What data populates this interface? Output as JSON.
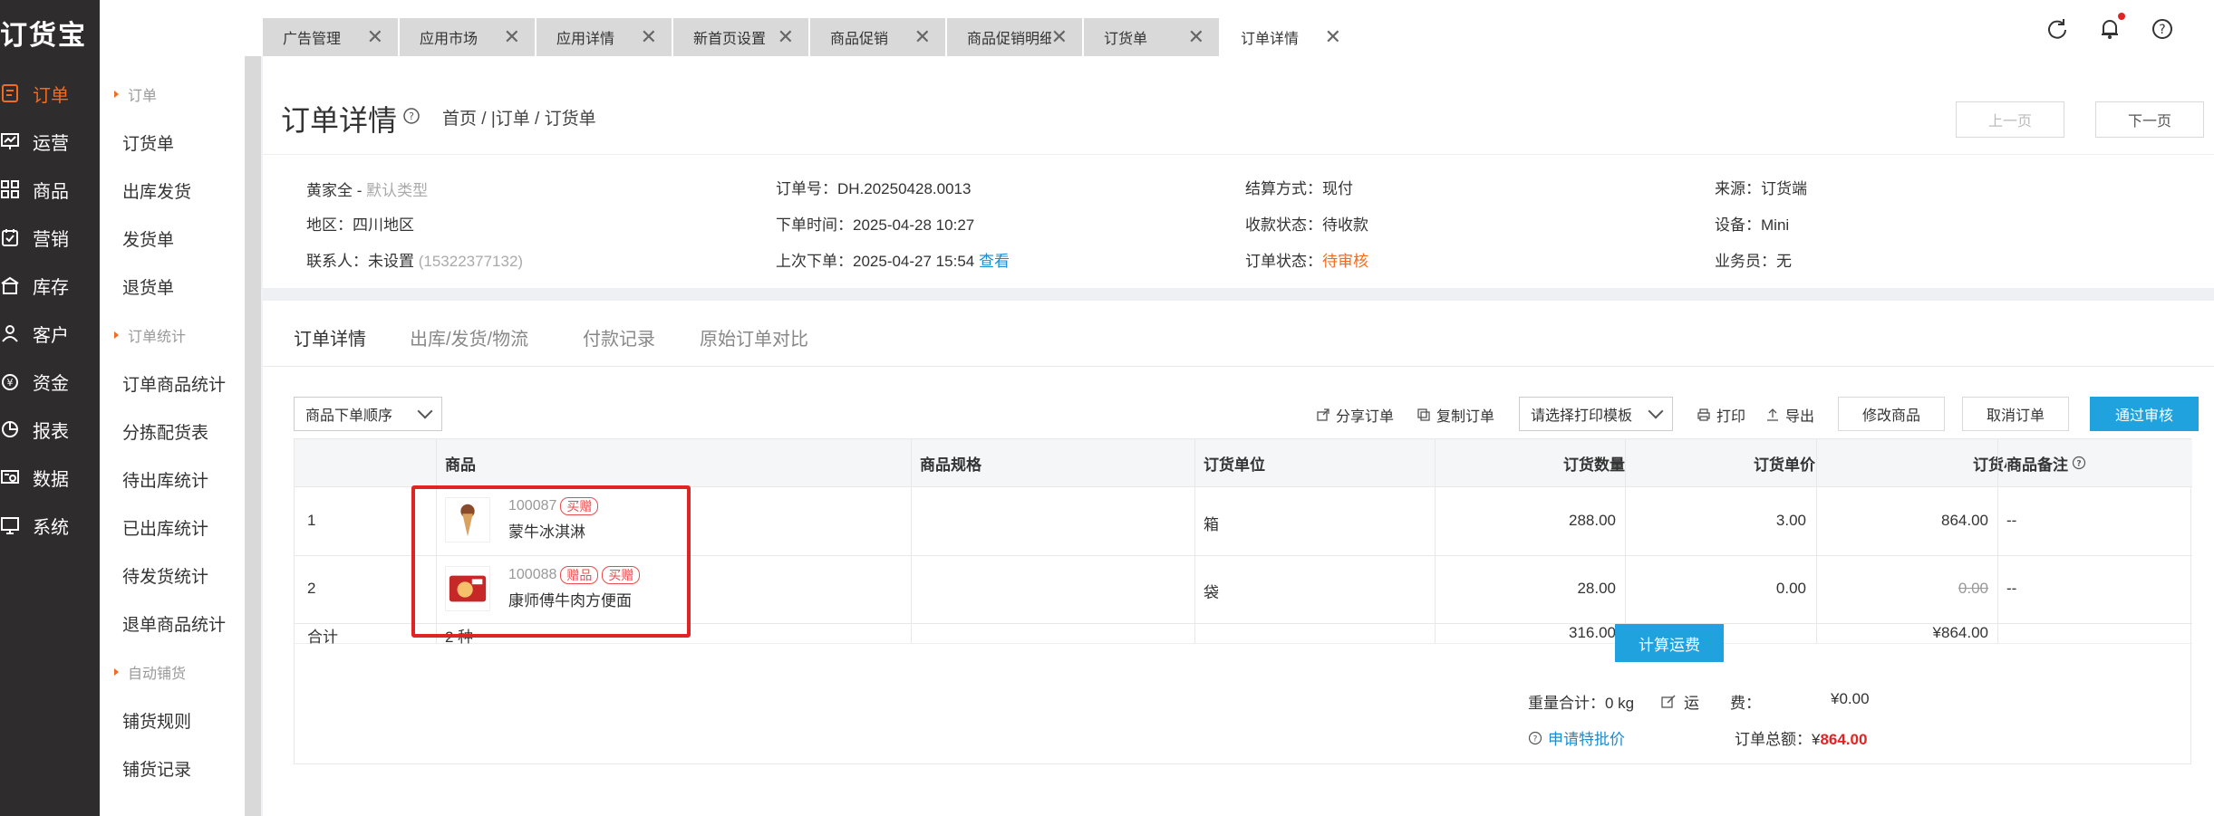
{
  "brand": "订货宝",
  "leftnav": [
    {
      "label": "订单",
      "icon": "order-icon",
      "active": true
    },
    {
      "label": "运营",
      "icon": "operate-icon",
      "active": false
    },
    {
      "label": "商品",
      "icon": "goods-icon",
      "active": false
    },
    {
      "label": "营销",
      "icon": "marketing-icon",
      "active": false
    },
    {
      "label": "库存",
      "icon": "inventory-icon",
      "active": false
    },
    {
      "label": "客户",
      "icon": "customer-icon",
      "active": false
    },
    {
      "label": "资金",
      "icon": "money-icon",
      "active": false
    },
    {
      "label": "报表",
      "icon": "report-icon",
      "active": false
    },
    {
      "label": "数据",
      "icon": "data-icon",
      "active": false
    },
    {
      "label": "系统",
      "icon": "system-icon",
      "active": false
    }
  ],
  "submenu": {
    "group1": "订单",
    "items1": [
      "订货单",
      "出库发货",
      "发货单",
      "退货单"
    ],
    "group2": "订单统计",
    "items2": [
      "订单商品统计",
      "分拣配货表",
      "待出库统计",
      "已出库统计",
      "待发货统计",
      "退单商品统计"
    ],
    "group3": "自动铺货",
    "items3": [
      "铺货规则",
      "铺货记录"
    ]
  },
  "tabs": [
    "广告管理",
    "应用市场",
    "应用详情",
    "新首页设置",
    "商品促销",
    "商品促销明细",
    "订货单",
    "订单详情"
  ],
  "page": {
    "title": "订单详情",
    "breadcrumb": "首页 / |订单 / 订货单",
    "prev": "上一页",
    "next": "下一页"
  },
  "info": {
    "customer": "黄家全",
    "customer_type": "默认类型",
    "region": "地区：四川地区",
    "contact": "联系人：未设置",
    "phone": "(15322377132)",
    "order_no": "订单号：DH.20250428.0013",
    "order_time": "下单时间：2025-04-28 10:27",
    "last_order": "上次下单：2025-04-27 15:54",
    "view": "查看",
    "settle": "结算方式：现付",
    "pay_status": "收款状态：待收款",
    "order_status_label": "订单状态：",
    "order_status": "待审核",
    "source": "来源：订货端",
    "device": "设备：Mini",
    "salesman": "业务员：无"
  },
  "detail_tabs": [
    "订单详情",
    "出库/发货/物流",
    "付款记录",
    "原始订单对比"
  ],
  "toolbar": {
    "sort": "商品下单顺序",
    "share": "分享订单",
    "copy": "复制订单",
    "print_template": "请选择打印模板",
    "print": "打印",
    "export": "导出",
    "modify": "修改商品",
    "cancel": "取消订单",
    "approve": "通过审核"
  },
  "table": {
    "headers": [
      "商品",
      "商品规格",
      "订货单位",
      "订货数量",
      "订货单价",
      "订货小计",
      "商品备注"
    ],
    "rows": [
      {
        "index": "1",
        "code": "100087",
        "tags": [
          "买赠"
        ],
        "name": "蒙牛冰淇淋",
        "spec": "",
        "unit": "箱",
        "qty": "288.00",
        "price": "3.00",
        "subtotal": "864.00",
        "note": "--"
      },
      {
        "index": "2",
        "code": "100088",
        "tags": [
          "赠品",
          "买赠"
        ],
        "name": "康师傅牛肉方便面",
        "spec": "",
        "unit": "袋",
        "qty": "28.00",
        "price": "0.00",
        "subtotal": "0.00",
        "note": "--"
      }
    ],
    "total": {
      "label": "合计",
      "kinds": "2 种",
      "qty": "316.00",
      "subtotal": "¥864.00"
    }
  },
  "summary": {
    "weight": "重量合计：0 kg",
    "freight_label": "运　　费：",
    "freight": "¥0.00",
    "calc": "计算运费",
    "special": "申请特批价",
    "total_label": "订单总额：¥",
    "total": "864.00"
  }
}
